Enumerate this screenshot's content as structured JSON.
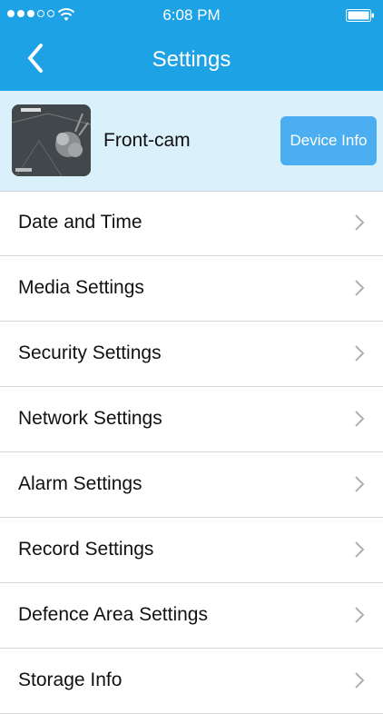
{
  "status_bar": {
    "time": "6:08 PM",
    "signal_icon": "signal-dots-icon",
    "wifi_icon": "wifi-icon",
    "battery_icon": "battery-icon"
  },
  "nav": {
    "title": "Settings",
    "back_icon": "chevron-left-icon"
  },
  "device": {
    "name": "Front-cam",
    "button_label": "Device Info",
    "thumbnail": "camera-thumbnail"
  },
  "settings_items": [
    {
      "label": "Date and Time"
    },
    {
      "label": "Media Settings"
    },
    {
      "label": "Security Settings"
    },
    {
      "label": "Network Settings"
    },
    {
      "label": "Alarm Settings"
    },
    {
      "label": "Record Settings"
    },
    {
      "label": "Defence Area Settings"
    },
    {
      "label": "Storage Info"
    }
  ],
  "colors": {
    "accent": "#1ea2e6",
    "device_bg": "#daf0fb",
    "button": "#4aaef0"
  }
}
